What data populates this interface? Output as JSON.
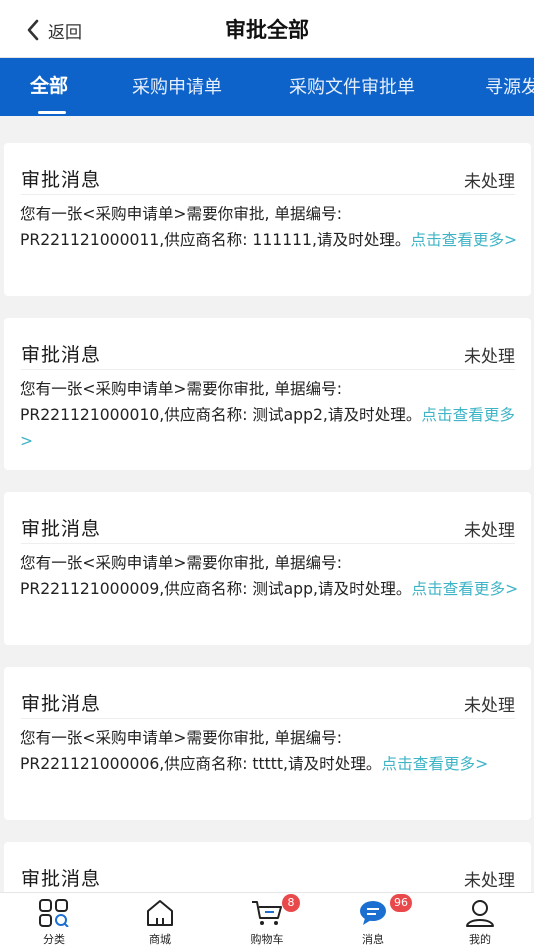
{
  "header": {
    "back_label": "返回",
    "title": "审批全部"
  },
  "tabs": [
    {
      "label": "全部",
      "active": true
    },
    {
      "label": "采购申请单",
      "active": false
    },
    {
      "label": "采购文件审批单",
      "active": false
    },
    {
      "label": "寻源发",
      "active": false
    }
  ],
  "messages": [
    {
      "title": "审批消息",
      "status": "未处理",
      "line1": "您有一张<采购申请单>需要你审批, 单据编号:",
      "line2": "PR221121000011,供应商名称:  111111,请及时处理。",
      "link": "点击查看更多>"
    },
    {
      "title": "审批消息",
      "status": "未处理",
      "line1": "您有一张<采购申请单>需要你审批, 单据编号:",
      "line2": "PR221121000010,供应商名称:  测试app2,请及时处理。",
      "link": "点击查看更多>"
    },
    {
      "title": "审批消息",
      "status": "未处理",
      "line1": "您有一张<采购申请单>需要你审批, 单据编号:",
      "line2": "PR221121000009,供应商名称:  测试app,请及时处理。",
      "link": "点击查看更多>"
    },
    {
      "title": "审批消息",
      "status": "未处理",
      "line1": "您有一张<采购申请单>需要你审批, 单据编号:",
      "line2": "PR221121000006,供应商名称:  ttttt,请及时处理。",
      "link": "点击查看更多>"
    },
    {
      "title": "审批消息",
      "status": "未处理"
    }
  ],
  "bottom_nav": [
    {
      "label": "分类",
      "icon": "grid-icon"
    },
    {
      "label": "商城",
      "icon": "home-icon"
    },
    {
      "label": "购物车",
      "icon": "cart-icon",
      "badge": "8"
    },
    {
      "label": "消息",
      "icon": "message-icon",
      "badge": "96"
    },
    {
      "label": "我的",
      "icon": "user-icon"
    }
  ],
  "colors": {
    "tab_bar": "#0d63c9",
    "link": "#3fb4c6",
    "badge": "#e9494b",
    "message_icon": "#1a6fd1"
  }
}
